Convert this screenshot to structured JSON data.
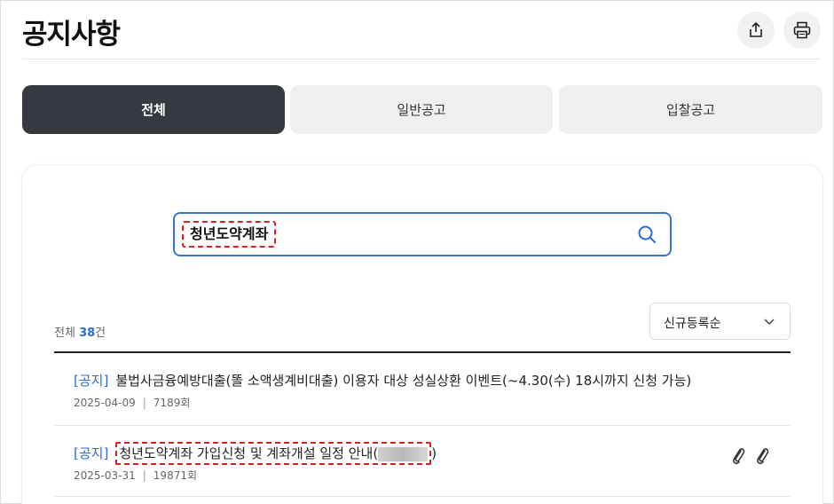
{
  "header": {
    "title": "공지사항",
    "share_icon": "share-icon",
    "print_icon": "print-icon"
  },
  "tabs": [
    {
      "label": "전체",
      "active": true
    },
    {
      "label": "일반공고",
      "active": false
    },
    {
      "label": "입찰공고",
      "active": false
    }
  ],
  "search": {
    "value": "청년도약계좌",
    "icon": "search-icon"
  },
  "results": {
    "prefix": "전체 ",
    "count": "38",
    "suffix": "건"
  },
  "sort": {
    "selected": "신규등록순",
    "icon": "chevron-down-icon"
  },
  "colors": {
    "accent": "#2a6bd1",
    "active_tab": "#343a40",
    "highlight": "#d92020"
  },
  "notices": [
    {
      "tag": "[공지]",
      "title": "불법사금융예방대출(똘 소액생계비대출) 이용자 대상 성실상환 이벤트(~4.30(수) 18시까지 신청 가능)",
      "date": "2025-04-09",
      "views": "7189회"
    },
    {
      "tag": "[공지]",
      "title_highlighted": "청년도약계좌 가입신청 및 계좌개설 일정 안내(",
      "title_end": ")",
      "date": "2025-03-31",
      "views": "19871회",
      "attachments": [
        "attachment-icon",
        "attachment-icon"
      ]
    }
  ]
}
